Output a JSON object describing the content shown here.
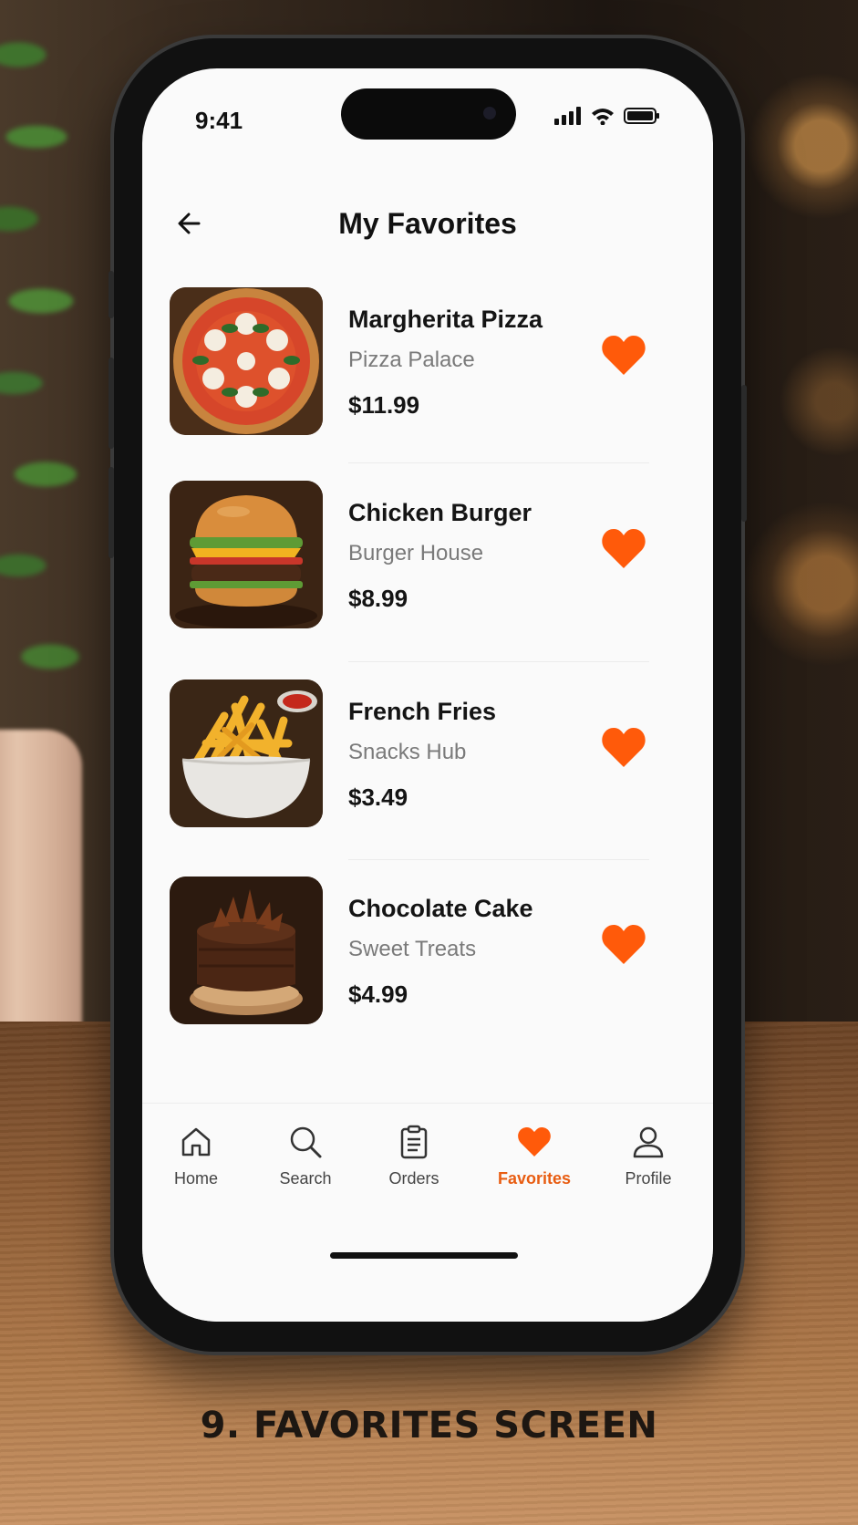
{
  "status_bar": {
    "time": "9:41"
  },
  "header": {
    "title": "My Favorites"
  },
  "favorites": [
    {
      "name": "Margherita Pizza",
      "shop": "Pizza Palace",
      "price": "$11.99",
      "image": "pizza"
    },
    {
      "name": "Chicken Burger",
      "shop": "Burger House",
      "price": "$8.99",
      "image": "burger"
    },
    {
      "name": "French Fries",
      "shop": "Snacks Hub",
      "price": "$3.49",
      "image": "fries"
    },
    {
      "name": "Chocolate Cake",
      "shop": "Sweet Treats",
      "price": "$4.99",
      "image": "cake"
    }
  ],
  "tabs": [
    {
      "label": "Home",
      "icon": "home-icon",
      "active": false
    },
    {
      "label": "Search",
      "icon": "search-icon",
      "active": false
    },
    {
      "label": "Orders",
      "icon": "clipboard-icon",
      "active": false
    },
    {
      "label": "Favorites",
      "icon": "heart-icon",
      "active": true
    },
    {
      "label": "Profile",
      "icon": "user-icon",
      "active": false
    }
  ],
  "caption": "9. FAVORITES SCREEN",
  "colors": {
    "accent": "#ff5a0a",
    "active_tab": "#e85d12",
    "screen_bg": "#fafafa"
  }
}
